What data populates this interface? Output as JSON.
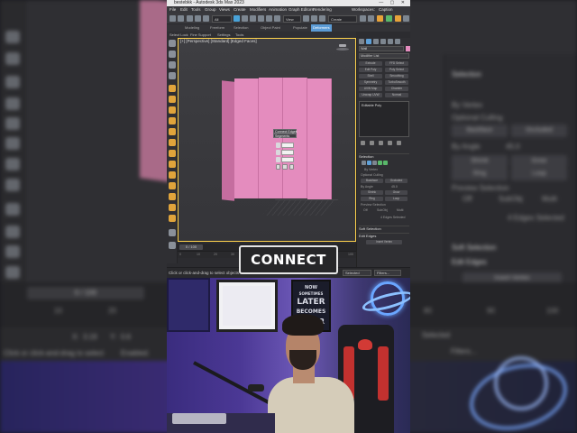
{
  "app": {
    "title": "bestebkk - Autodesk 3ds Max 2023",
    "menu": [
      "File",
      "Edit",
      "Tools",
      "Group",
      "Views",
      "Create",
      "Modifiers",
      "Animation",
      "Graph Editors",
      "Rendering"
    ],
    "workspace_label": "Workspaces:",
    "user_label": "Caption",
    "selection_set_placeholder": "Create Selection Se",
    "ribbon_tabs": [
      "Modeling",
      "Freeform",
      "Selection",
      "Object Paint",
      "Populate",
      "Deformers"
    ],
    "active_ribbon_tab": "Deformers",
    "ribbon_row2": [
      "Select Lock",
      "Fine Support",
      "Settings",
      "Tools"
    ]
  },
  "viewport": {
    "label": "[+] [Perspective] [Standard] [Edged Faces]"
  },
  "quad_menu": {
    "items": [
      "Connect Edges",
      "Segments"
    ]
  },
  "timeline": {
    "frame": "0 / 100",
    "ticks": [
      "0",
      "10",
      "20",
      "30",
      "40",
      "50",
      "60",
      "70",
      "80",
      "90",
      "100"
    ]
  },
  "status": {
    "prompt": "Click or click-and-drag to select objects",
    "selected": "Selected",
    "filters": "Filters..."
  },
  "command_panel": {
    "object_name": "Wall",
    "modifier_list": "Modifier List",
    "buttons": [
      "Extrude",
      "FFD Select",
      "Edit Poly",
      "Poly Select",
      "Shell",
      "Smoothing",
      "Symmetry",
      "TurboSmooth",
      "UVW Map",
      "Chamfer",
      "Unwrap UVW",
      "Normal"
    ],
    "stack_item": "Editable Poly",
    "selection_header": "Selection",
    "by_vertex": "By Vertex",
    "optional_culling": "Optional Culling",
    "backface": "Backface",
    "occluded": "Occluded",
    "by_angle": "By Angle",
    "angle_value": "45.0",
    "shrink": "Shrink",
    "grow": "Grow",
    "ring": "Ring",
    "loop": "Loop",
    "preview_selection": "Preview Selection",
    "preview_off": "Off",
    "preview_subobj": "SubObj",
    "preview_multi": "Multi",
    "edges_selected": "4 Edges Selected",
    "soft_selection": "Soft Selection",
    "edit_edges": "Edit Edges",
    "insert_vertex": "Insert Vertex"
  },
  "overlay": {
    "caption": "CONNECT"
  },
  "poster": {
    "lines": [
      "NOW",
      "SOMETIMES",
      "LATER",
      "BECOMES",
      "NEVER"
    ]
  },
  "background": {
    "frame": "0 / 100",
    "ruler": [
      "10",
      "20",
      "30",
      "40",
      "50",
      "60",
      "70",
      "80",
      "90",
      "100"
    ],
    "prompt": "Click or click-and-drag to select",
    "x_label": "X:",
    "x_value": "3.19",
    "y_label": "Y:",
    "y_value": "0.6",
    "enabled": "Enabled:",
    "selected": "Selected",
    "filters": "Filters...",
    "selection": "Selection",
    "by_vertex": "By Vertex",
    "optional_culling": "Optional Culling",
    "backface": "Backface",
    "occluded": "Occluded",
    "by_angle": "By Angle",
    "angle_value": "45.0",
    "shrink": "Shrink",
    "grow": "Grow",
    "ring": "Ring",
    "loop": "Loop",
    "preview_selection": "Preview Selection",
    "preview_off": "Off",
    "preview_subobj": "SubObj",
    "preview_multi": "Multi",
    "edges_selected": "4 Edges Selected",
    "soft_selection": "Soft Selection",
    "edit_edges": "Edit Edges",
    "insert_vertex": "Insert Vertex"
  },
  "colors": {
    "wall_pink": "#e48cbe",
    "viewport_border": "#ffd34d",
    "accent_blue": "#5b9bd5",
    "webcam_purple": "#4b3895"
  }
}
